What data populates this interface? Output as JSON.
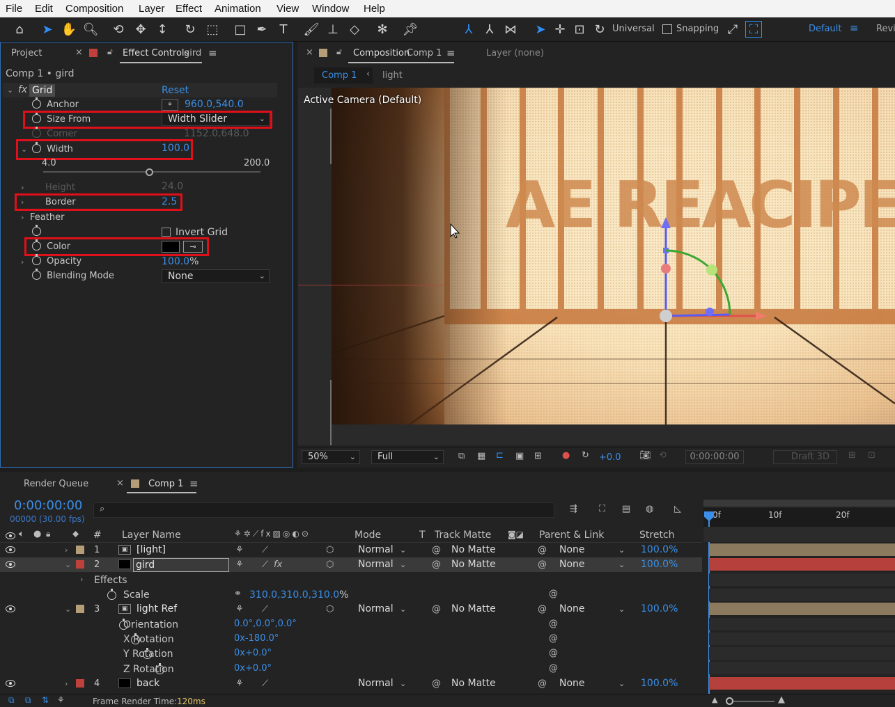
{
  "menu": [
    "File",
    "Edit",
    "Composition",
    "Layer",
    "Effect",
    "Animation",
    "View",
    "Window",
    "Help"
  ],
  "toolbar": {
    "universal_label": "Universal",
    "snapping_label": "Snapping",
    "workspace": "Default",
    "review_label": "Revi"
  },
  "left_panel": {
    "tab_project": "Project",
    "tab_effect_controls": "Effect Controls",
    "tab_effect_layer": "gird",
    "breadcrumb": "Comp 1 • gird",
    "effect_name": "Grid",
    "reset_label": "Reset",
    "properties": {
      "anchor": {
        "label": "Anchor",
        "value": "960.0,540.0"
      },
      "size_from": {
        "label": "Size From",
        "value": "Width Slider"
      },
      "corner": {
        "label": "Corner",
        "value": "1152.0,648.0"
      },
      "width": {
        "label": "Width",
        "value": "100.0",
        "slider_min": "4.0",
        "slider_max": "200.0",
        "slider_fraction": 0.49
      },
      "height": {
        "label": "Height",
        "value": "24.0"
      },
      "border": {
        "label": "Border",
        "value": "2.5"
      },
      "feather": {
        "label": "Feather"
      },
      "invert_grid": {
        "label": "Invert Grid"
      },
      "color": {
        "label": "Color",
        "value": "#000000"
      },
      "opacity": {
        "label": "Opacity",
        "value": "100.0",
        "unit": "%"
      },
      "blending_mode": {
        "label": "Blending Mode",
        "value": "None"
      }
    }
  },
  "comp_panel": {
    "tab_composition": "Composition",
    "tab_comp_name": "Comp 1",
    "tab_layer": "Layer (none)",
    "crumb_comp": "Comp 1",
    "crumb_light": "light",
    "camera_label": "Active Camera (Default)",
    "scene_text": "AE REACIPE",
    "footer": {
      "zoom": "50%",
      "resolution": "Full",
      "exposure": "+0.0",
      "timecode": "0:00:00:00",
      "draft3d": "Draft 3D"
    }
  },
  "timeline": {
    "tab_render_queue": "Render Queue",
    "tab_comp": "Comp 1",
    "current_time": "0:00:00:00",
    "frame_info": "00000 (30.00 fps)",
    "search_placeholder": "",
    "columns": {
      "hash": "#",
      "layer_name": "Layer Name",
      "mode": "Mode",
      "t": "T",
      "track_matte": "Track Matte",
      "parent_link": "Parent & Link",
      "stretch": "Stretch"
    },
    "ruler": [
      "0f",
      "10f",
      "20f"
    ],
    "layers": [
      {
        "num": "1",
        "name": "[light]",
        "mode": "Normal",
        "matte": "No Matte",
        "parent": "None",
        "stretch": "100.0%",
        "color": "#b59d78"
      },
      {
        "num": "2",
        "name": "gird",
        "mode": "Normal",
        "matte": "No Matte",
        "parent": "None",
        "stretch": "100.0%",
        "color": "#c0413c"
      },
      {
        "num": "3",
        "name": "light Ref",
        "mode": "Normal",
        "matte": "No Matte",
        "parent": "None",
        "stretch": "100.0%",
        "color": "#b59d78"
      },
      {
        "num": "4",
        "name": "back",
        "mode": "Normal",
        "matte": "No Matte",
        "parent": "None",
        "stretch": "100.0%",
        "color": "#c0413c"
      }
    ],
    "effects_label": "Effects",
    "scale": {
      "label": "Scale",
      "value": "310.0,310.0,310.0",
      "unit": "%"
    },
    "orientation": {
      "label": "Orientation",
      "value": "0.0°,0.0°,0.0°"
    },
    "x_rotation": {
      "label": "X Rotation",
      "value": "0x-180.0°"
    },
    "y_rotation": {
      "label": "Y Rotation",
      "value": "0x+0.0°"
    },
    "z_rotation": {
      "label": "Z Rotation",
      "value": "0x+0.0°"
    },
    "render_time_label": "Frame Render Time:",
    "render_time_value": "120ms"
  }
}
